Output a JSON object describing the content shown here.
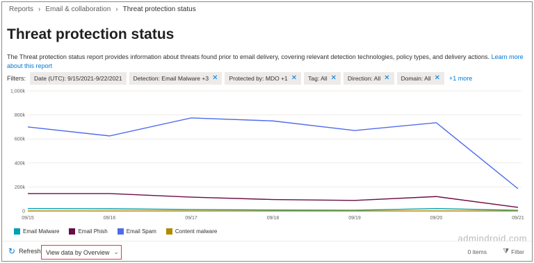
{
  "breadcrumb": [
    "Reports",
    "Email & collaboration",
    "Threat protection status"
  ],
  "page": {
    "title": "Threat protection status",
    "description": "The Threat protection status report provides information about threats found prior to email delivery, covering relevant detection technologies, policy types, and delivery actions.",
    "learn_more": "Learn more about this report"
  },
  "filters": {
    "label": "Filters:",
    "chips": [
      {
        "text": "Date (UTC): 9/15/2021-9/22/2021",
        "removable": false
      },
      {
        "text": "Detection: Email Malware +3",
        "removable": true
      },
      {
        "text": "Protected by: MDO +1",
        "removable": true
      },
      {
        "text": "Tag: All",
        "removable": true
      },
      {
        "text": "Direction: All",
        "removable": true
      },
      {
        "text": "Domain: All",
        "removable": true
      }
    ],
    "more": "+1 more"
  },
  "chart_data": {
    "type": "line",
    "x": [
      "09/15",
      "09/16",
      "09/17",
      "09/18",
      "09/19",
      "09/20",
      "09/21"
    ],
    "yticks": [
      "0",
      "200k",
      "400k",
      "600k",
      "800k",
      "1,000k"
    ],
    "ylim": [
      0,
      1000000
    ],
    "grid": true,
    "legend_position": "bottom-left",
    "series": [
      {
        "name": "Email Malware",
        "color": "#00a0b4",
        "values": [
          20000,
          18000,
          12000,
          8000,
          6000,
          20000,
          5000
        ]
      },
      {
        "name": "Email Phish",
        "color": "#6b0a45",
        "values": [
          145000,
          145000,
          115000,
          95000,
          88000,
          120000,
          30000
        ]
      },
      {
        "name": "Email Spam",
        "color": "#4f6bed",
        "values": [
          700000,
          625000,
          775000,
          750000,
          670000,
          735000,
          185000
        ]
      },
      {
        "name": "Content malware",
        "color": "#b08a00",
        "values": [
          0,
          0,
          0,
          0,
          0,
          0,
          0
        ]
      }
    ]
  },
  "commandbar": {
    "refresh": "Refresh",
    "view": "View data by Overview",
    "items": "0 items",
    "filter": "Filter"
  },
  "watermark": "admindroid.com"
}
